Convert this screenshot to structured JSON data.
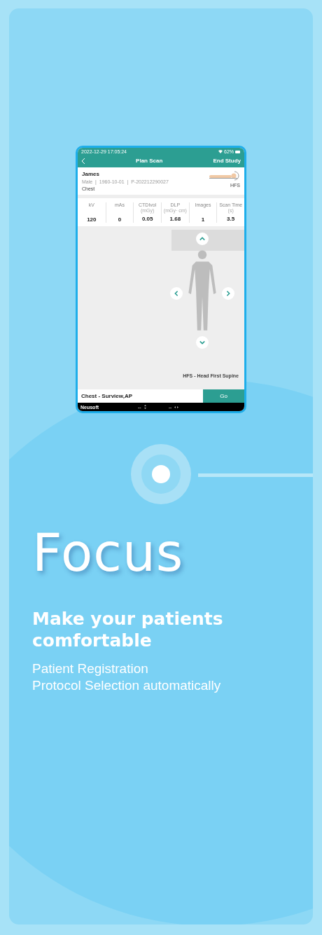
{
  "phone": {
    "status_bar": {
      "time": "2022-12-29 17:05:24",
      "battery": "62%"
    },
    "header": {
      "title": "Plan Scan",
      "action": "End Study"
    },
    "patient": {
      "name": "James",
      "details": "Male  |  1960-10-01  |  P-202212290027",
      "body_part": "Chest",
      "position": "HFS"
    },
    "stats": [
      {
        "label": "kV",
        "value": "120"
      },
      {
        "label": "mAs",
        "value": "0"
      },
      {
        "label": "CTDIvol",
        "unit": "(mGy)",
        "value": "0.05"
      },
      {
        "label": "DLP",
        "unit": "(mGy· cm)",
        "value": "1.68"
      },
      {
        "label": "Images",
        "value": "1"
      },
      {
        "label": "Scan Time",
        "unit": "(s)",
        "value": "3.5"
      }
    ],
    "position_caption": "HFS - Head First Supine",
    "protocol": "Chest - Surview,AP",
    "go_button": "Go",
    "bottom_bar": {
      "brand": "Neusoft",
      "reading_1": "--",
      "reading_2": "--"
    }
  },
  "title": "Focus",
  "heading": "Make your patients comfortable",
  "lines": [
    "Patient Registration",
    "Protocol Selection automatically"
  ]
}
